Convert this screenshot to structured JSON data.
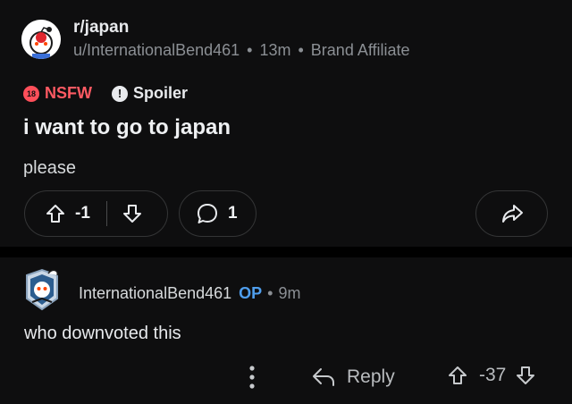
{
  "post": {
    "subreddit": "r/japan",
    "author": "u/InternationalBend461",
    "age": "13m",
    "flair": "Brand Affiliate",
    "nsfw_badge": "18",
    "nsfw_label": "NSFW",
    "spoiler_label": "Spoiler",
    "title": "i want to go to japan",
    "body": "please",
    "score": "-1",
    "comment_count": "1"
  },
  "comment": {
    "author": "InternationalBend461",
    "op_label": "OP",
    "age": "9m",
    "body": "who downvoted this",
    "reply_label": "Reply",
    "score": "-37"
  },
  "colors": {
    "background": "#0e0e0f",
    "nsfw": "#ff4f5a",
    "op": "#4f9eed",
    "muted": "#8b8f94"
  },
  "icons": [
    "subreddit-avatar-icon",
    "upvote-icon",
    "downvote-icon",
    "comment-icon",
    "share-icon",
    "more-vertical-icon",
    "reply-icon"
  ]
}
